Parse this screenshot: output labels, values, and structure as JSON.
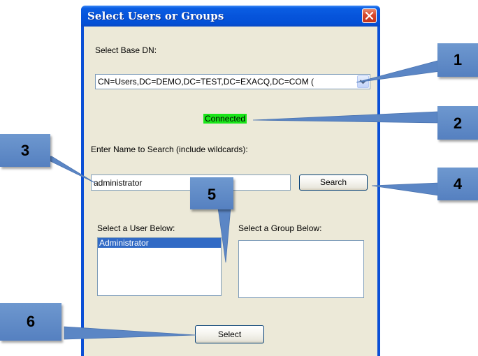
{
  "window": {
    "title": "Select Users or Groups"
  },
  "base_dn": {
    "label": "Select Base DN:",
    "value": "CN=Users,DC=DEMO,DC=TEST,DC=EXACQ,DC=COM ("
  },
  "status": {
    "text": "Connected",
    "color": "#1ae51a"
  },
  "search": {
    "label": "Enter Name to Search (include wildcards):",
    "value": "administrator",
    "button_label": "Search"
  },
  "users": {
    "label": "Select a User Below:",
    "items": [
      "Administrator"
    ],
    "selected_index": 0
  },
  "groups": {
    "label": "Select a Group Below:",
    "items": []
  },
  "actions": {
    "select_label": "Select"
  },
  "callouts": [
    {
      "number": "1"
    },
    {
      "number": "2"
    },
    {
      "number": "3"
    },
    {
      "number": "4"
    },
    {
      "number": "5"
    },
    {
      "number": "6"
    }
  ],
  "colors": {
    "callout_fill": "#5b86c5",
    "titlebar": "#0654db",
    "dialog_face": "#ece9d8",
    "selection": "#316ac5"
  }
}
